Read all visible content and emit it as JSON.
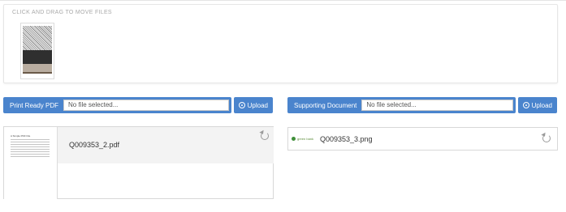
{
  "drag_area": {
    "caption": "CLICK AND DRAG TO MOVE FILES"
  },
  "left_upload": {
    "label": "Print Ready PDF",
    "field_value": "No file selected...",
    "button_label": "Upload",
    "button_icon": "upload-circle-icon"
  },
  "right_upload": {
    "label": "Supporting Document",
    "field_value": "No file selected...",
    "button_label": "Upload",
    "button_icon": "upload-circle-icon"
  },
  "left_file": {
    "name": "Q009353_2.pdf",
    "preview_title": "A Simple PDF File",
    "action_icon": "refresh-icon"
  },
  "right_file": {
    "name": "Q009353_3.png",
    "preview_text": "green bank",
    "action_icon": "refresh-icon"
  },
  "colors": {
    "accent": "#4a84cd",
    "panel_border": "#d8d8d8",
    "card_head_bg": "#f3f3f3"
  }
}
